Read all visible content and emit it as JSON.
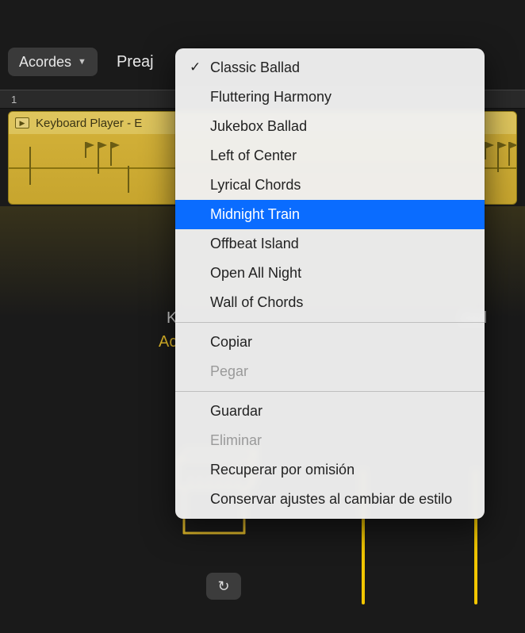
{
  "topbar": {
    "mode_label": "Acordes",
    "second_label": "Preaj"
  },
  "ruler": {
    "marker": "1"
  },
  "track": {
    "title": "Keyboard Player - E"
  },
  "panel": {
    "k_label": "K",
    "ac_label": "Ac",
    "right_label": "dad"
  },
  "menu": {
    "presets": [
      {
        "label": "Classic Ballad",
        "checked": true
      },
      {
        "label": "Fluttering Harmony"
      },
      {
        "label": "Jukebox Ballad"
      },
      {
        "label": "Left of Center"
      },
      {
        "label": "Lyrical Chords"
      },
      {
        "label": "Midnight Train",
        "highlight": true
      },
      {
        "label": "Offbeat Island"
      },
      {
        "label": "Open All Night"
      },
      {
        "label": "Wall of Chords"
      }
    ],
    "actions1": [
      {
        "label": "Copiar"
      },
      {
        "label": "Pegar",
        "disabled": true
      }
    ],
    "actions2": [
      {
        "label": "Guardar"
      },
      {
        "label": "Eliminar",
        "disabled": true
      },
      {
        "label": "Recuperar por omisión"
      },
      {
        "label": "Conservar ajustes al cambiar de estilo"
      }
    ]
  }
}
